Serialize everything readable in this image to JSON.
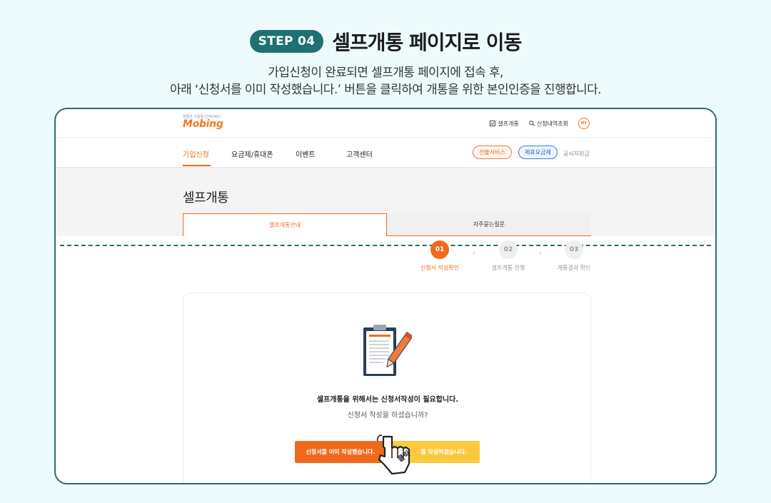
{
  "header": {
    "step_badge": "STEP 04",
    "title": "셀프개통 페이지로 이동",
    "desc_line1": "가입신청이 완료되면 셀프개통 페이지에 접속 후,",
    "desc_line2": "아래 ‘신청서를 이미 작성했습니다.’ 버튼을 클릭하여 개통을 위한 본인인증을 진행합니다."
  },
  "site": {
    "logo_tagline": "알뜰한 이동통신(MVNO)",
    "logo": "Mobing",
    "top_links": [
      {
        "label": "셀프개통",
        "icon": "checkbox-icon"
      },
      {
        "label": "신청내역조회",
        "icon": "search-icon"
      }
    ],
    "my_badge": "MY",
    "gnb": [
      "가입신청",
      "요금제/휴대폰",
      "이벤트",
      "고객센터"
    ],
    "gnb_pills": [
      "선불서비스",
      "제휴요금제"
    ],
    "gnb_extra": "공시지원금"
  },
  "page": {
    "title": "셀프개통",
    "tabs": [
      "셀프개통안내",
      "자주묻는질문"
    ],
    "steps": [
      {
        "num": "01",
        "label": "신청서 작성확인"
      },
      {
        "num": "02",
        "label": "셀프개통 진행"
      },
      {
        "num": "03",
        "label": "개통결과 확인"
      }
    ],
    "card_main": "셀프개통을 위해서는 신청서작성이 필요합니다.",
    "card_sub": "신청서 작성을 하셨습니까?",
    "btn_primary": "신청서를 이미 작성했습니다.",
    "btn_secondary": "를 작성하겠습니다.",
    "click_label": "클릭"
  },
  "colors": {
    "accent": "#f06a1e",
    "teal": "#1f7070",
    "yellow": "#fbc93d",
    "blue": "#3d7bd6"
  }
}
